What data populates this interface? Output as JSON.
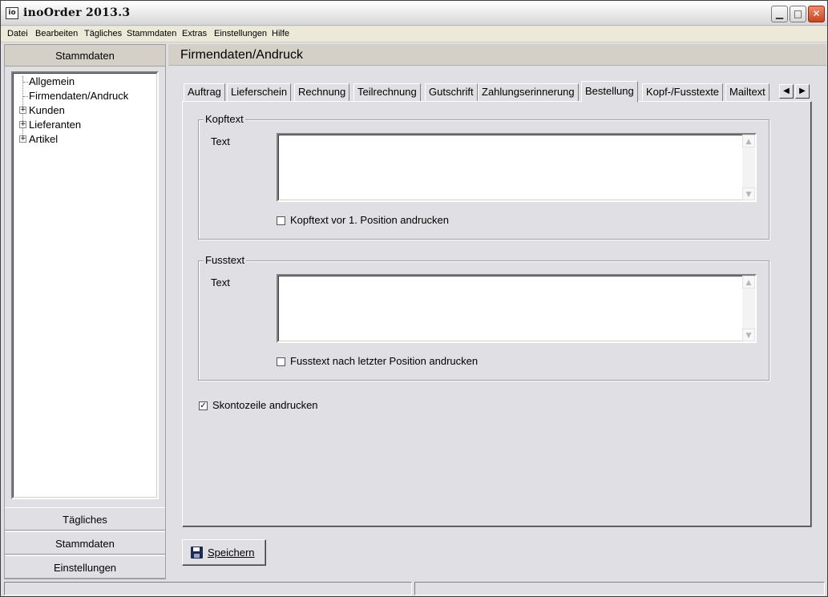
{
  "window": {
    "title": "inoOrder 2013.3",
    "icon_label": "io"
  },
  "menubar": {
    "items": [
      "Datei",
      "Bearbeiten",
      "Tägliches",
      "Stammdaten",
      "Extras",
      "Einstellungen",
      "Hilfe"
    ]
  },
  "left_panel": {
    "header": "Stammdaten",
    "tree": [
      {
        "label": "Allgemein",
        "expandable": false
      },
      {
        "label": "Firmendaten/Andruck",
        "expandable": false
      },
      {
        "label": "Kunden",
        "expandable": true
      },
      {
        "label": "Lieferanten",
        "expandable": true
      },
      {
        "label": "Artikel",
        "expandable": true
      }
    ],
    "nav_buttons": [
      "Tägliches",
      "Stammdaten",
      "Einstellungen"
    ]
  },
  "main": {
    "title": "Firmendaten/Andruck",
    "tabs": [
      "Auftrag",
      "Lieferschein",
      "Rechnung",
      "Teilrechnung",
      "Gutschrift",
      "Zahlungserinnerung",
      "Bestellung",
      "Kopf-/Fusstexte",
      "Mailtext"
    ],
    "active_tab": "Bestellung",
    "kopftext": {
      "legend": "Kopftext",
      "text_label": "Text",
      "text_value": "",
      "checkbox_label": "Kopftext vor 1. Position andrucken",
      "checked": false
    },
    "fusstext": {
      "legend": "Fusstext",
      "text_label": "Text",
      "text_value": "",
      "checkbox_label": "Fusstext nach letzter Position andrucken",
      "checked": false
    },
    "skonto": {
      "label": "Skontozeile andrucken",
      "checked": true
    },
    "save_label": "Speichern"
  }
}
